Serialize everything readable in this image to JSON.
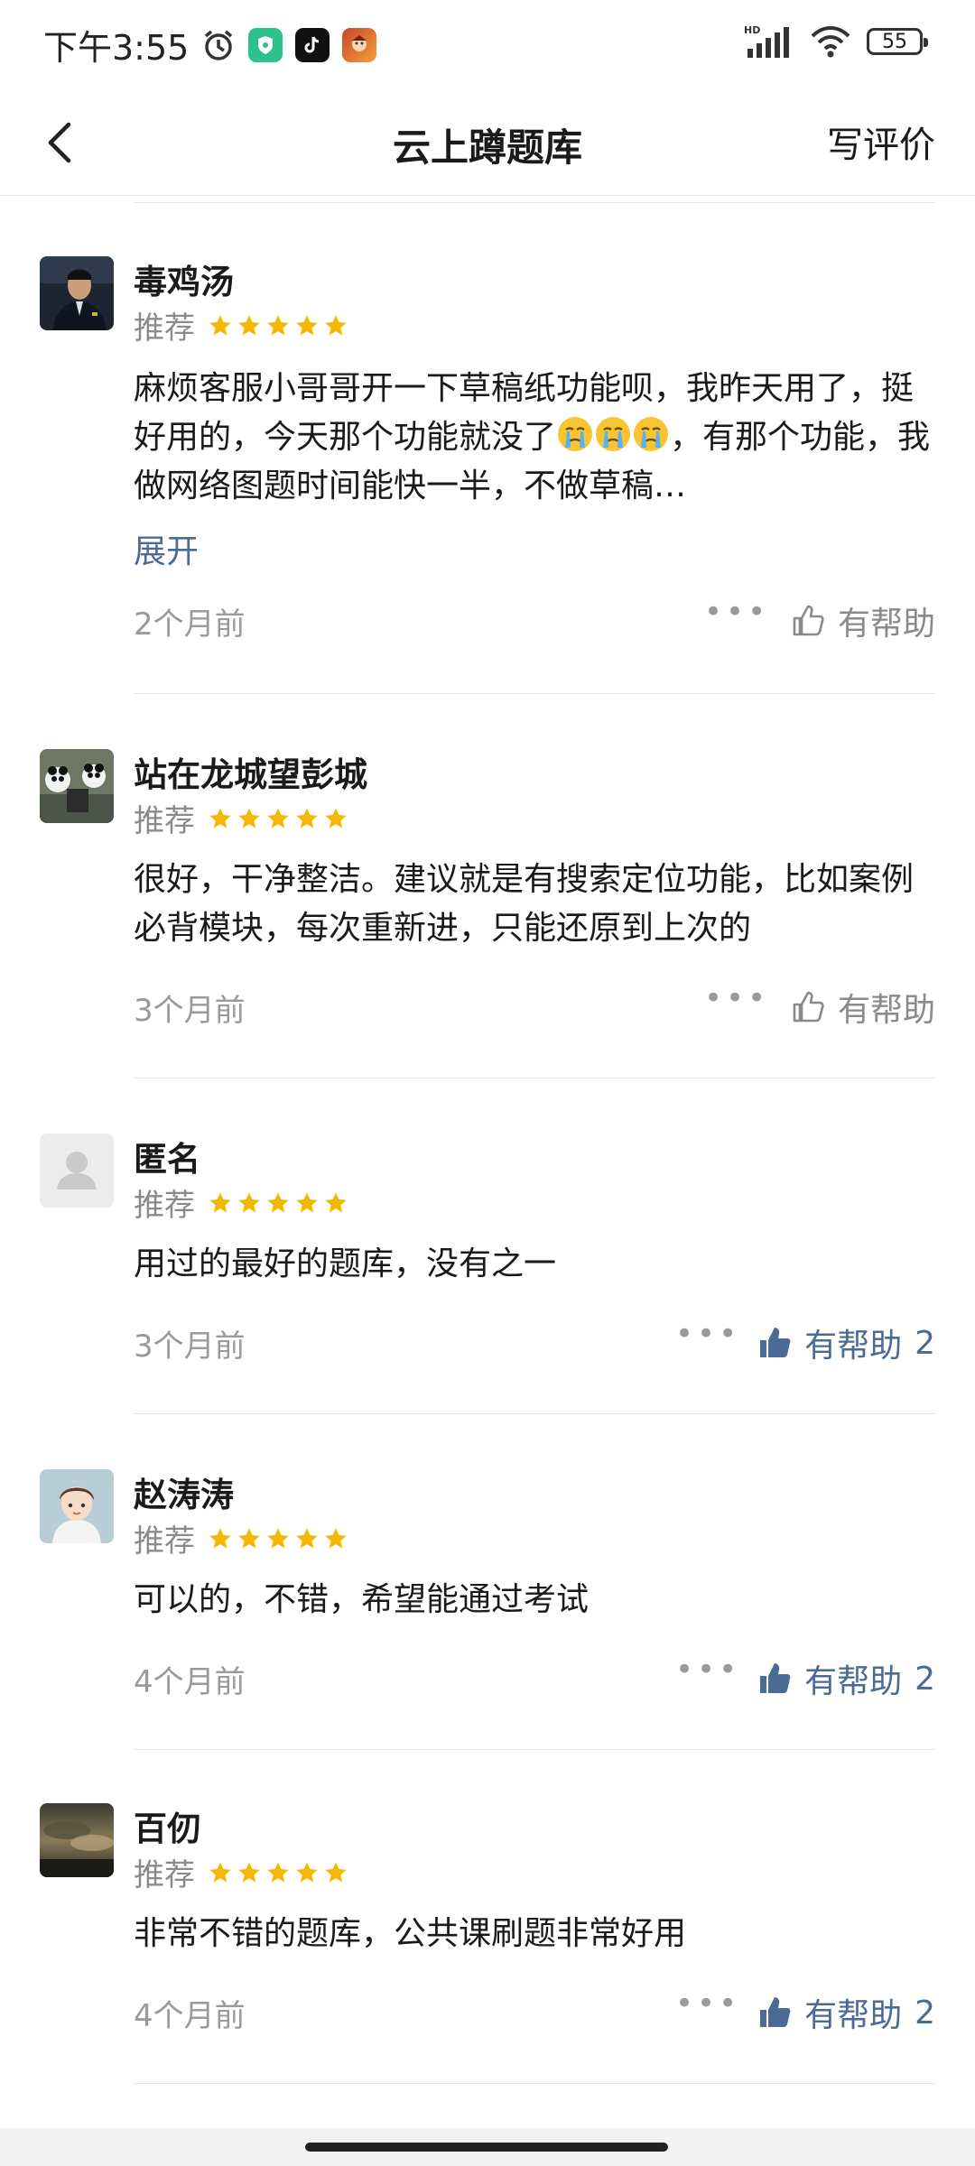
{
  "status_bar": {
    "time": "下午3:55",
    "battery": "55",
    "icons": [
      "alarm-icon",
      "vpn-shield-icon",
      "tiktok-icon",
      "game-icon",
      "hd-signal-icon",
      "wifi-icon",
      "battery-icon"
    ]
  },
  "header": {
    "title": "云上蹲题库",
    "write_review": "写评价",
    "back_icon": "back-arrow-icon"
  },
  "colors": {
    "accent": "#4b6a95",
    "star": "#f5b800",
    "muted": "#9a9a9a",
    "divider": "#e6e6e6"
  },
  "reviews": [
    {
      "user": "毒鸡汤",
      "rating_label": "推荐",
      "stars": 5,
      "content_a": "麻烦客服小哥哥开一下草稿纸功能呗，我昨天用了，挺好用的，今天那个功能就没了",
      "emoji": "😭😭😭",
      "content_b": "，有那个功能，我做网络图题时间能快一半，不做草稿…",
      "expand": "展开",
      "time": "2个月前",
      "helpful_label": "有帮助",
      "helpful_count": "",
      "helpful_active": false
    },
    {
      "user": "站在龙城望彭城",
      "rating_label": "推荐",
      "stars": 5,
      "content": "很好，干净整洁。建议就是有搜索定位功能，比如案例必背模块，每次重新进，只能还原到上次的",
      "time": "3个月前",
      "helpful_label": "有帮助",
      "helpful_count": "",
      "helpful_active": false
    },
    {
      "user": "匿名",
      "rating_label": "推荐",
      "stars": 5,
      "content": "用过的最好的题库，没有之一",
      "time": "3个月前",
      "helpful_label": "有帮助",
      "helpful_count": "2",
      "helpful_active": true
    },
    {
      "user": "赵涛涛",
      "rating_label": "推荐",
      "stars": 5,
      "content": "可以的，不错，希望能通过考试",
      "time": "4个月前",
      "helpful_label": "有帮助",
      "helpful_count": "2",
      "helpful_active": true
    },
    {
      "user": "百仞",
      "rating_label": "推荐",
      "stars": 5,
      "content": "非常不错的题库，公共课刷题非常好用",
      "time": "4个月前",
      "helpful_label": "有帮助",
      "helpful_count": "2",
      "helpful_active": true
    }
  ]
}
